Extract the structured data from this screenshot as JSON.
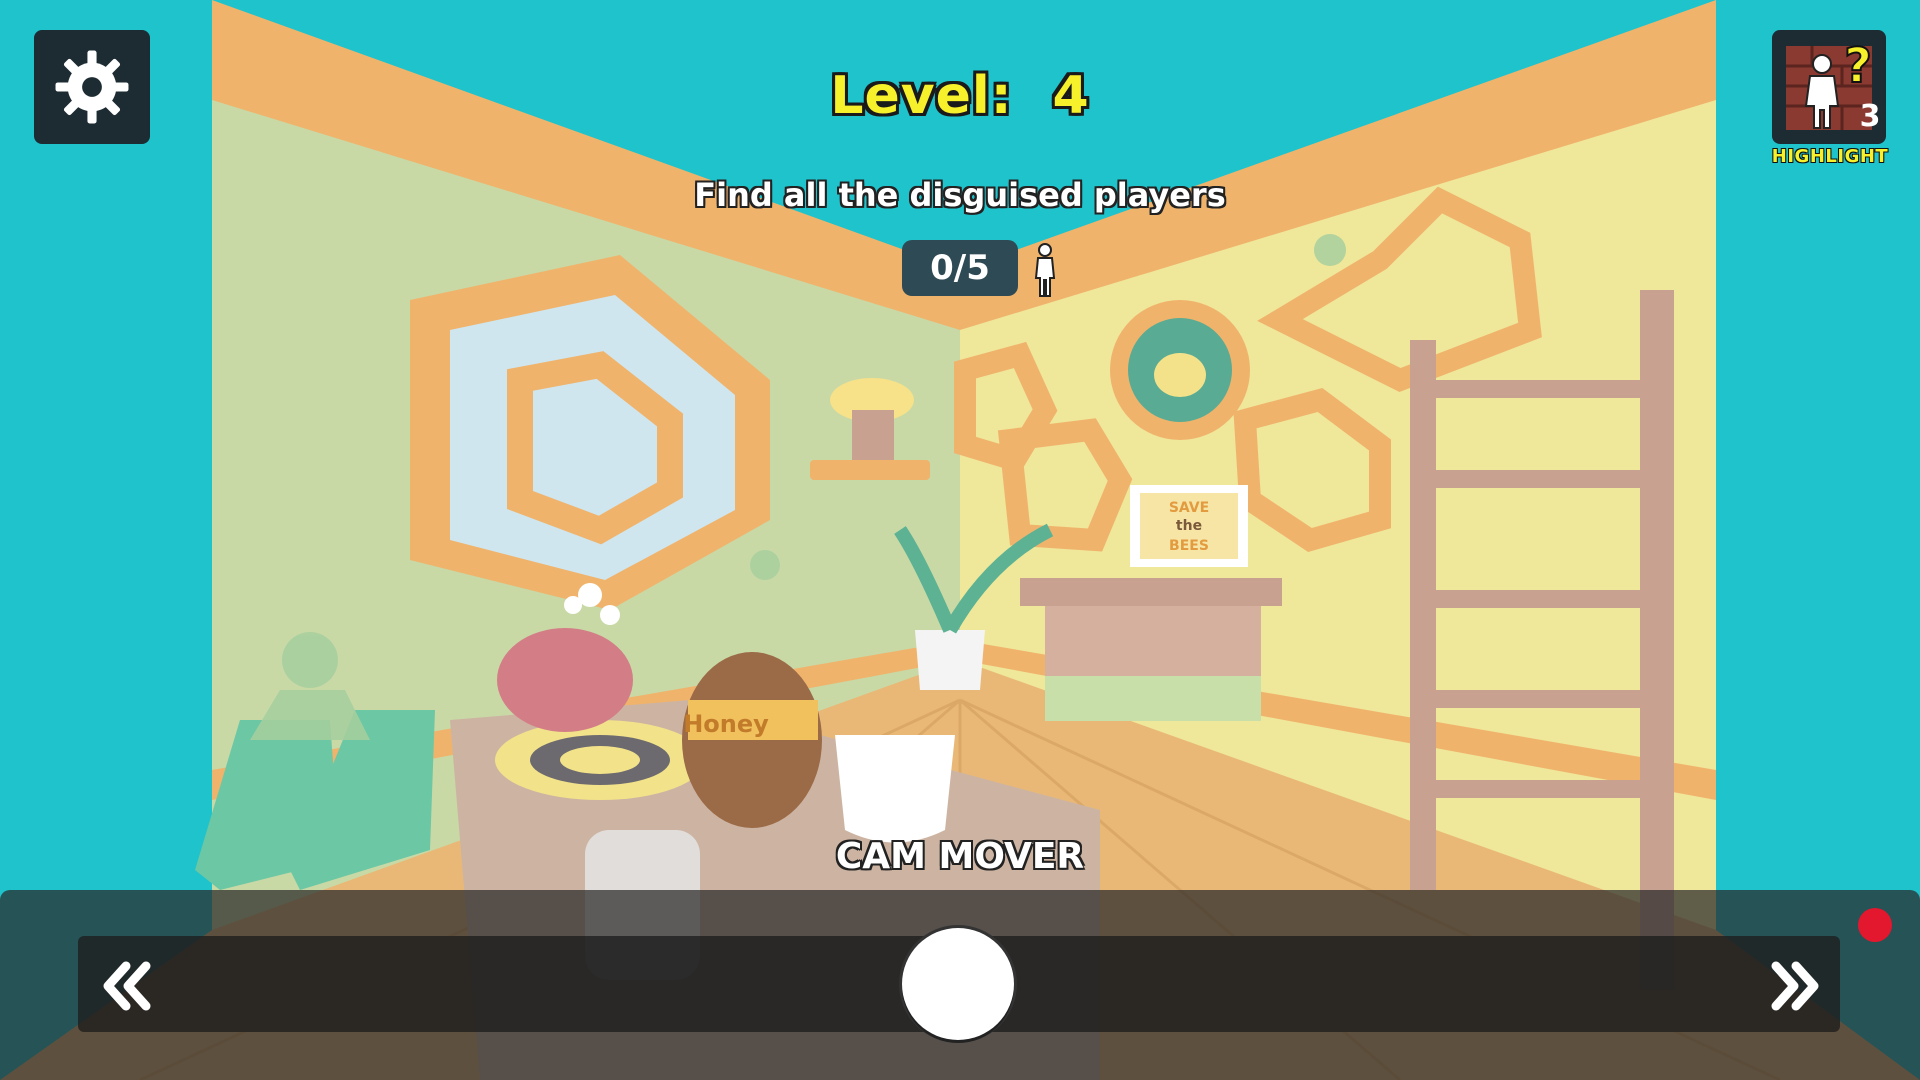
{
  "hud": {
    "level_label": "Level:",
    "level_value": "4",
    "objective": "Find all the disguised players",
    "found_count": "0/5",
    "cam_label": "CAM MOVER",
    "highlight": {
      "label": "HIGHLIGHT",
      "count": "3",
      "question_mark": "?"
    }
  },
  "scene": {
    "barrel_label": "Honey",
    "sign_lines": [
      "SAVE",
      "the",
      "BEES"
    ]
  },
  "icons": {
    "settings": "gear-icon",
    "counter": "person-icon",
    "highlight": "disguised-person-icon",
    "left": "double-chevron-left-icon",
    "right": "double-chevron-right-icon"
  },
  "colors": {
    "sky": "#1ec3cc",
    "level_text": "#f6f12a",
    "record_dot": "#e3172e",
    "hud_dark": "#1d2b33"
  }
}
